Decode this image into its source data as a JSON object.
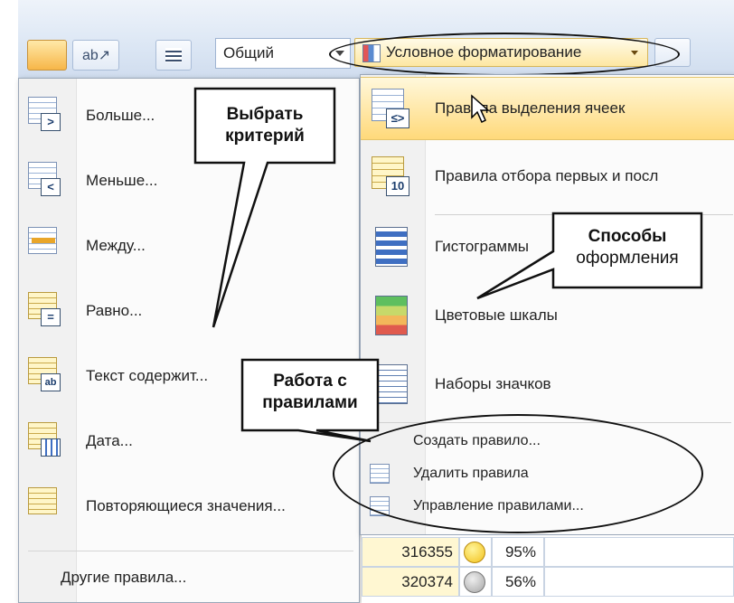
{
  "ribbon": {
    "number_format": "Общий",
    "conditional_formatting_label": "Условное форматирование"
  },
  "left_menu": {
    "items": [
      {
        "label": "Больше...",
        "badge": ">"
      },
      {
        "label": "Меньше...",
        "badge": "<"
      },
      {
        "label": "Между..."
      },
      {
        "label": "Равно...",
        "badge": "="
      },
      {
        "label": "Текст содержит...",
        "badge": "ab"
      },
      {
        "label": "Дата..."
      },
      {
        "label": "Повторяющиеся значения..."
      }
    ],
    "other_rules": "Другие правила..."
  },
  "right_menu": {
    "items": [
      {
        "label": "Правила выделения ячеек",
        "badge": "≤>"
      },
      {
        "label": "Правила отбора первых и посл",
        "badge": "10"
      },
      {
        "label": "Гистограммы"
      },
      {
        "label": "Цветовые шкалы"
      },
      {
        "label": "Наборы значков"
      }
    ],
    "sub_items": [
      {
        "label": "Создать правило..."
      },
      {
        "label": "Удалить правила"
      },
      {
        "label": "Управление правилами..."
      }
    ]
  },
  "sheet": {
    "rows": [
      {
        "value": "316355",
        "face": "happy",
        "percent": "95%"
      },
      {
        "value": "320374",
        "face": "sad",
        "percent": "56%"
      }
    ]
  },
  "callouts": {
    "choose_criterion": [
      "Выбрать",
      "критерий"
    ],
    "design_ways": [
      "Способы",
      "оформления"
    ],
    "rules_work": [
      "Работа с",
      "правилами"
    ]
  }
}
